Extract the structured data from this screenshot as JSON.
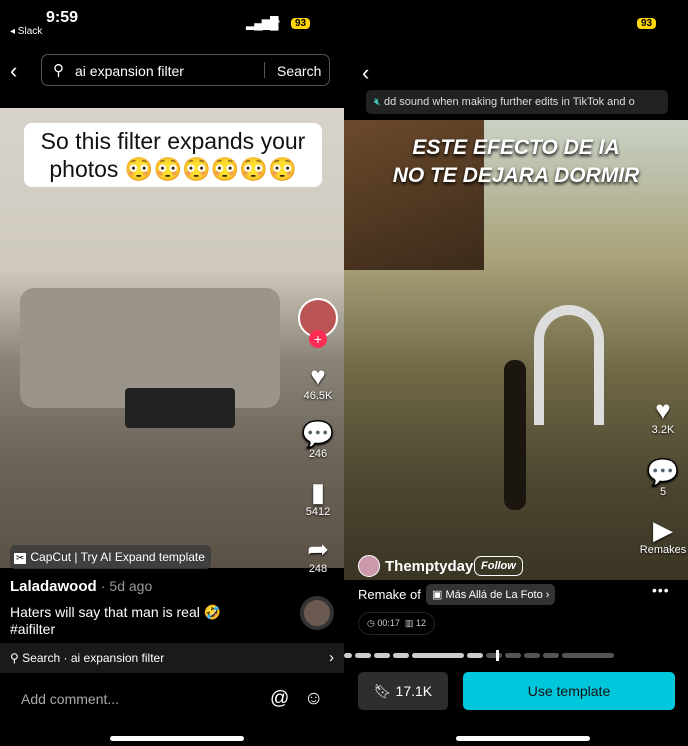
{
  "left": {
    "status": {
      "time": "9:59",
      "back_app": "◂ Slack",
      "battery": "93"
    },
    "search": {
      "query": "ai expansion filter",
      "button": "Search"
    },
    "video": {
      "caption": "So this filter expands your photos 😳😳😳😳😳😳",
      "likes": "46.5K",
      "comments": "246",
      "saves": "5412",
      "shares": "248",
      "template_badge": "CapCut | Try AI Expand template"
    },
    "author": "Laladawood",
    "age": "· 5d ago",
    "description": "Haters will say that man is real 🤣",
    "hashtag": "#aifilter",
    "search_bar": {
      "label": "Search ·",
      "query": "ai expansion filter"
    },
    "comment_placeholder": "Add comment..."
  },
  "right": {
    "battery": "93",
    "toast": "dd sound when making further edits in TikTok and o",
    "video": {
      "overlay_text_1": "ESTE EFECTO DE IA",
      "overlay_text_2": "NO TE DEJARA DORMIR",
      "likes": "3.2K",
      "comments": "5",
      "remakes_label": "Remakes"
    },
    "creator": "Themptyday",
    "follow": "Follow",
    "remake_of": "Remake of",
    "template_name": "Más Allá de La Foto",
    "duration": "00:17",
    "clips": "12",
    "progress": 0.56,
    "saves": "17.1K",
    "use_template": "Use template",
    "accent": "#00c8dc"
  }
}
